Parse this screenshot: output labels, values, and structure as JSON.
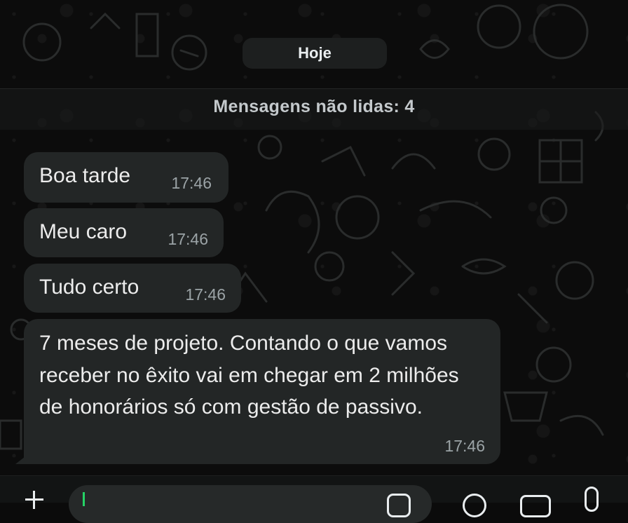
{
  "chat": {
    "day_separator": "Hoje",
    "unread_banner": "Mensagens não lidas: 4",
    "messages": [
      {
        "text": "Boa tarde",
        "time": "17:46"
      },
      {
        "text": "Meu caro",
        "time": "17:46"
      },
      {
        "text": "Tudo certo",
        "time": "17:46"
      },
      {
        "text": "7 meses de projeto. Contando o que vamos receber no êxito vai em chegar em 2 milhões de honorários só com gestão de passivo.",
        "time": "17:46"
      }
    ]
  },
  "composer": {
    "value": "",
    "icons": [
      "plus-icon",
      "sticker-icon",
      "payment-icon",
      "camera-icon",
      "microphone-icon"
    ]
  },
  "colors": {
    "background": "#0c0c0c",
    "bubble": "#232626",
    "text": "#ececec",
    "timestamp": "#9ba3a6",
    "caret": "#25d366"
  }
}
